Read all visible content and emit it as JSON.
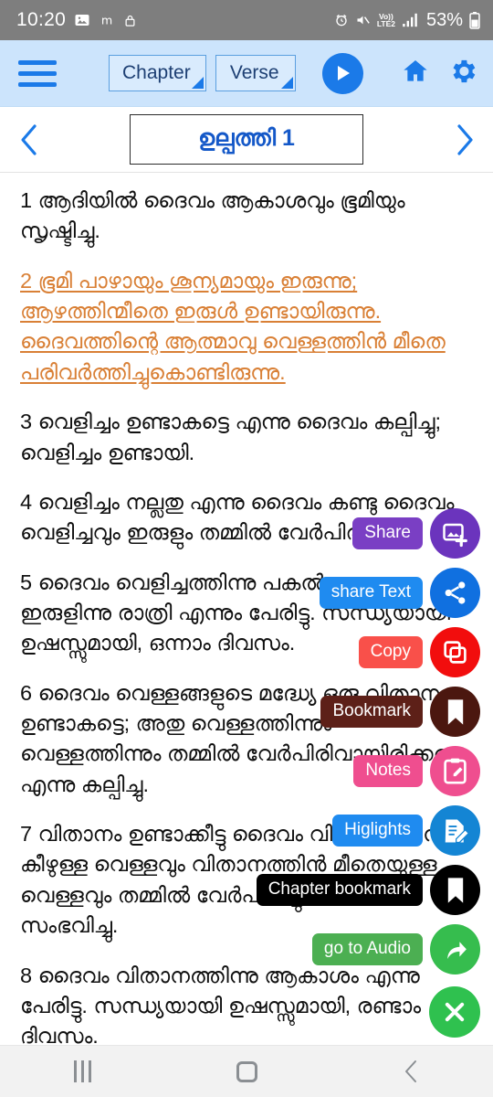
{
  "status_bar": {
    "time": "10:20",
    "battery_percent": "53%",
    "network_label_top": "Vo))",
    "network_label_bottom": "LTE2",
    "icons": [
      "photo-icon",
      "m-app-icon",
      "lock-icon",
      "alarm-icon",
      "mute-icon",
      "volte-icon",
      "signal-icon",
      "battery-icon"
    ]
  },
  "toolbar": {
    "menu_icon": "hamburger-menu-icon",
    "chapter_spinner": "Chapter",
    "verse_spinner": "Verse",
    "play_icon": "play-icon",
    "home_icon": "home-icon",
    "settings_icon": "gear-icon"
  },
  "chapter_nav": {
    "prev_icon": "chevron-left-icon",
    "title": "ഉല്പത്തി 1",
    "next_icon": "chevron-right-icon"
  },
  "verses": [
    {
      "number": "1",
      "text": "1 ആദിയിൽ ദൈവം ആകാശവും ഭൂമിയും സൃഷ്ടിച്ചു.",
      "highlighted": false
    },
    {
      "number": "2",
      "text": "2 ഭൂമി പാഴായും ശൂന്യമായും ഇരുന്നു; ആഴത്തിന്മീതെ ഇരുൾ ഉണ്ടായിരുന്നു. ദൈവത്തിന്റെ ആത്മാവു വെള്ളത്തിൻ മീതെ പരിവർത്തിച്ചുകൊണ്ടിരുന്നു.",
      "highlighted": true
    },
    {
      "number": "3",
      "text": "3 വെളിച്ചം ഉണ്ടാകട്ടെ എന്നു ദൈവം കല്പിച്ചു; വെളിച്ചം ഉണ്ടായി.",
      "highlighted": false
    },
    {
      "number": "4",
      "text": "4 വെളിച്ചം നല്ലതു എന്നു ദൈവം കണ്ടു ദൈവം വെളിച്ചവും ഇരുളും തമ്മിൽ വേർപിരിച്ചു.",
      "highlighted": false
    },
    {
      "number": "5",
      "text": "5 ദൈവം വെളിച്ചത്തിന്നു പകൽ എന്നും ഇരുളിന്നു രാത്രി എന്നും പേരിട്ടു. സന്ധ്യയായി ഉഷസ്സുമായി, ഒന്നാം ദിവസം.",
      "highlighted": false
    },
    {
      "number": "6",
      "text": "6 ദൈവം വെള്ളങ്ങളുടെ മദ്ധ്യേ ഒരു വിതാനം ഉണ്ടാകട്ടെ; അതു വെള്ളത്തിന്നും വെള്ളത്തിന്നും തമ്മിൽ വേർപിരിവായിരിക്കട്ടെ എന്നു കല്പിച്ചു.",
      "highlighted": false
    },
    {
      "number": "7",
      "text": "7 വിതാനം ഉണ്ടാക്കീട്ടു ദൈവം വിതാനത്തിൻ കീഴുള്ള വെള്ളവും വിതാനത്തിൻ മീതെയുള്ള വെള്ളവും തമ്മിൽ വേർപിരിച്ചു; അങ്ങനെ സംഭവിച്ചു.",
      "highlighted": false
    },
    {
      "number": "8",
      "text": "8 ദൈവം വിതാനത്തിന്നു ആകാശം എന്നു പേരിട്ടു. സന്ധ്യയായി ഉഷസ്സുമായി, രണ്ടാം ദിവസം.",
      "highlighted": false
    }
  ],
  "fab_menu": [
    {
      "label": "Share",
      "icon": "image-add-icon",
      "label_color": "#7a3fc4",
      "fab_color": "#6b34bd"
    },
    {
      "label": "share Text",
      "icon": "share-network-icon",
      "label_color": "#1f8bf0",
      "fab_color": "#1070e0"
    },
    {
      "label": "Copy",
      "icon": "copy-icon",
      "label_color": "#f9504a",
      "fab_color": "#f20d0d"
    },
    {
      "label": "Bookmark",
      "icon": "bookmark-icon",
      "label_color": "#5d2018",
      "fab_color": "#4b170f"
    },
    {
      "label": "Notes",
      "icon": "note-edit-icon",
      "label_color": "#ef4e8f",
      "fab_color": "#ef4e8f"
    },
    {
      "label": "Higlights",
      "icon": "highlight-edit-icon",
      "label_color": "#1f8bf0",
      "fab_color": "#1485d4"
    },
    {
      "label": "Chapter bookmark",
      "icon": "bookmark-icon",
      "label_color": "#000000",
      "fab_color": "#000000"
    },
    {
      "label": "go to Audio",
      "icon": "arrow-forward-icon",
      "label_color": "#4caf52",
      "fab_color": "#36bd4e"
    }
  ],
  "fab_close": {
    "icon": "close-icon",
    "color": "#2fc14f"
  },
  "bottom_nav": {
    "recents_icon": "recents-icon",
    "home_icon": "home-square-icon",
    "back_icon": "back-chevron-icon"
  },
  "theme": {
    "accent_blue": "#1b7ae8",
    "toolbar_bg": "#ccE4fc",
    "highlight_orange": "#d98036",
    "status_bar_bg": "#7e7e7e"
  }
}
